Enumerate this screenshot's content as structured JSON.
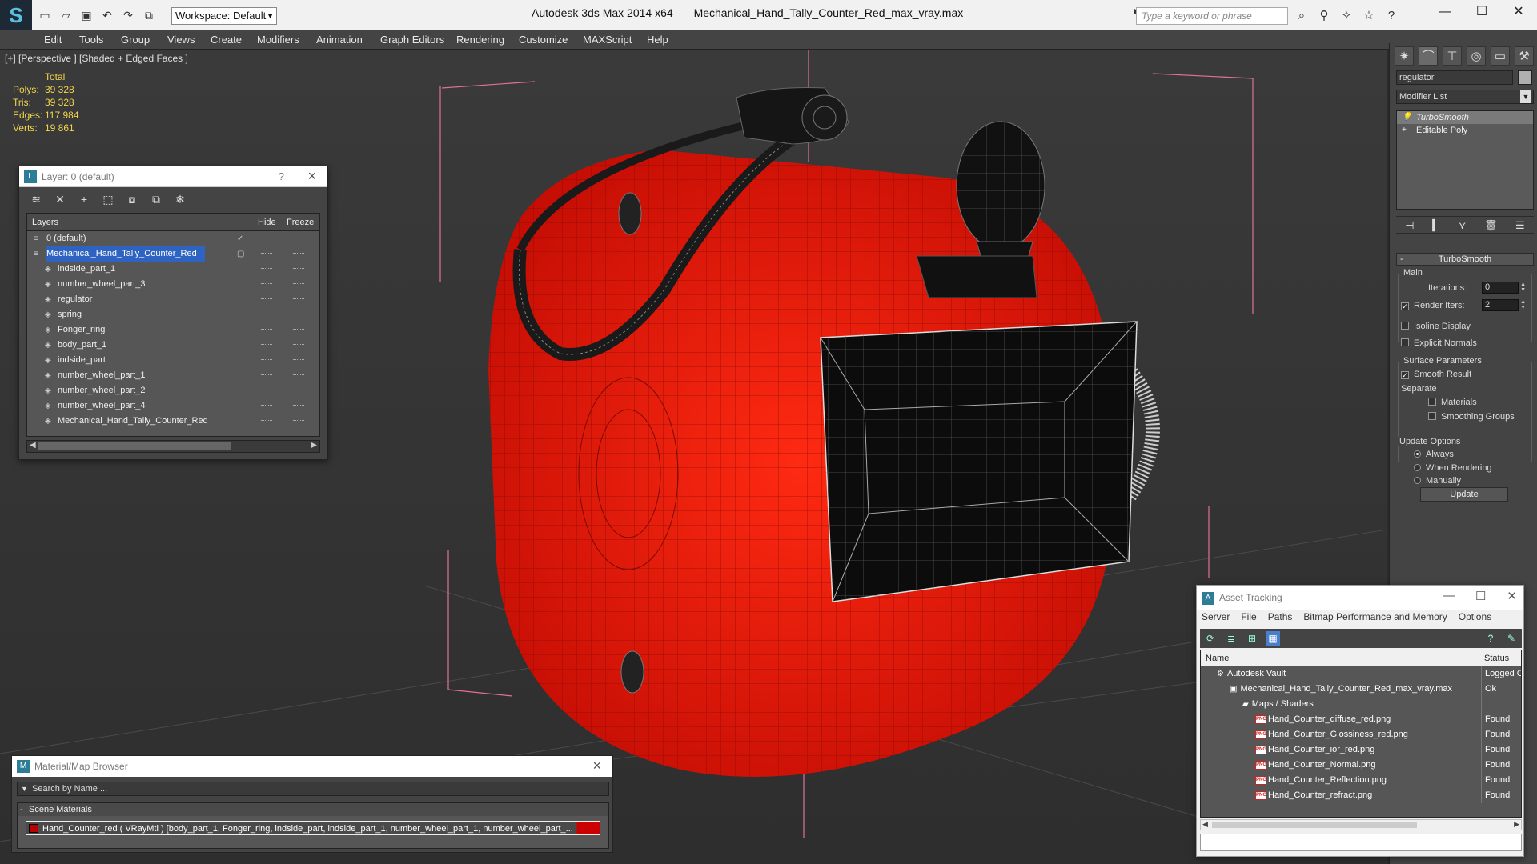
{
  "window": {
    "app_title": "Autodesk 3ds Max  2014 x64",
    "file_title": "Mechanical_Hand_Tally_Counter_Red_max_vray.max",
    "workspace": "Workspace: Default",
    "search_placeholder": "Type a keyword or phrase",
    "min_glyph": "—",
    "max_glyph": "☐",
    "close_glyph": "✕"
  },
  "menu": [
    "Edit",
    "Tools",
    "Group",
    "Views",
    "Create",
    "Modifiers",
    "Animation",
    "Graph Editors",
    "Rendering",
    "Customize",
    "MAXScript",
    "Help"
  ],
  "viewport": {
    "label": "[+] [Perspective ] [Shaded + Edged Faces ]",
    "stats": {
      "header": "Total",
      "rows": [
        {
          "k": "Polys:",
          "v": "39 328"
        },
        {
          "k": "Tris:",
          "v": "39 328"
        },
        {
          "k": "Edges:",
          "v": "117 984"
        },
        {
          "k": "Verts:",
          "v": "19 861"
        }
      ]
    }
  },
  "layer_window": {
    "title": "Layer: 0 (default)",
    "help": "?",
    "columns": {
      "name": "Layers",
      "hide": "Hide",
      "freeze": "Freeze"
    },
    "rows": [
      {
        "name": "0 (default)",
        "level": 0
      },
      {
        "name": "Mechanical_Hand_Tally_Counter_Red",
        "level": 0
      },
      {
        "name": "indside_part_1",
        "level": 1
      },
      {
        "name": "number_wheel_part_3",
        "level": 1
      },
      {
        "name": "regulator",
        "level": 1
      },
      {
        "name": "spring",
        "level": 1
      },
      {
        "name": "Fonger_ring",
        "level": 1
      },
      {
        "name": "body_part_1",
        "level": 1
      },
      {
        "name": "indside_part",
        "level": 1
      },
      {
        "name": "number_wheel_part_1",
        "level": 1
      },
      {
        "name": "number_wheel_part_2",
        "level": 1
      },
      {
        "name": "number_wheel_part_4",
        "level": 1
      },
      {
        "name": "Mechanical_Hand_Tally_Counter_Red",
        "level": 1
      }
    ]
  },
  "command_panel": {
    "object_name": "regulator",
    "modifier_list": "Modifier List",
    "stack": [
      "TurboSmooth",
      "Editable Poly"
    ],
    "rollout": "TurboSmooth",
    "main_label": "Main",
    "iterations_label": "Iterations:",
    "iterations_value": "0",
    "render_iters_label": "Render Iters:",
    "render_iters_value": "2",
    "isoline": "Isoline Display",
    "explicit": "Explicit Normals",
    "surface_label": "Surface Parameters",
    "smooth_result": "Smooth Result",
    "separate": "Separate",
    "materials": "Materials",
    "smoothing_groups": "Smoothing Groups",
    "update_options": "Update Options",
    "always": "Always",
    "when_rendering": "When Rendering",
    "manually": "Manually",
    "update_button": "Update"
  },
  "material_browser": {
    "title": "Material/Map Browser",
    "search": "Search by Name ...",
    "section": "Scene Materials",
    "item": "Hand_Counter_red  ( VRayMtl )  [body_part_1, Fonger_ring, indside_part, indside_part_1, number_wheel_part_1, number_wheel_part_..."
  },
  "asset_tracking": {
    "title": "Asset Tracking",
    "menu": [
      "Server",
      "File",
      "Paths",
      "Bitmap Performance and Memory",
      "Options"
    ],
    "columns": {
      "name": "Name",
      "status": "Status"
    },
    "rows": [
      {
        "name": "Autodesk Vault",
        "status": "Logged Out",
        "level": 0
      },
      {
        "name": "Mechanical_Hand_Tally_Counter_Red_max_vray.max",
        "status": "Ok",
        "level": 1
      },
      {
        "name": "Maps / Shaders",
        "status": "",
        "level": 2
      },
      {
        "name": "Hand_Counter_diffuse_red.png",
        "status": "Found",
        "level": 3
      },
      {
        "name": "Hand_Counter_Glossiness_red.png",
        "status": "Found",
        "level": 3
      },
      {
        "name": "Hand_Counter_ior_red.png",
        "status": "Found",
        "level": 3
      },
      {
        "name": "Hand_Counter_Normal.png",
        "status": "Found",
        "level": 3
      },
      {
        "name": "Hand_Counter_Reflection.png",
        "status": "Found",
        "level": 3
      },
      {
        "name": "Hand_Counter_refract.png",
        "status": "Found",
        "level": 3
      }
    ]
  },
  "colors": {
    "accent": "#2f63c2",
    "model_red": "#e0160a",
    "stats_yellow": "#f3d44a"
  }
}
